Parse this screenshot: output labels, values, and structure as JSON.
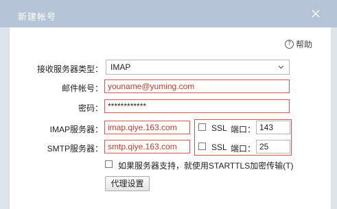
{
  "window": {
    "title": "新建帐号",
    "help_label": "帮助"
  },
  "form": {
    "protocol_label": "接收服务器类型：",
    "protocol_value": "IMAP",
    "account_label": "邮件帐号：",
    "account_value": "youname@yuming.com",
    "password_label": "密码：",
    "password_value": "************",
    "imap_label": "IMAP服务器：",
    "imap_value": "imap.qiye.163.com",
    "smtp_label": "SMTP服务器：",
    "smtp_value": "smtp.qiye.163.com",
    "ssl_label": "SSL",
    "port_label": "端口：",
    "imap_port": "143",
    "smtp_port": "25",
    "starttls_label": "如果服务器支持，就使用STARTTLS加密传输(T)",
    "proxy_button": "代理设置"
  },
  "colors": {
    "titlebar": "#b5c4d7",
    "error_border": "#d9534f",
    "error_text": "#c0392b"
  },
  "icons": [
    "close-icon",
    "help-icon",
    "chevron-down-icon",
    "checkbox"
  ]
}
